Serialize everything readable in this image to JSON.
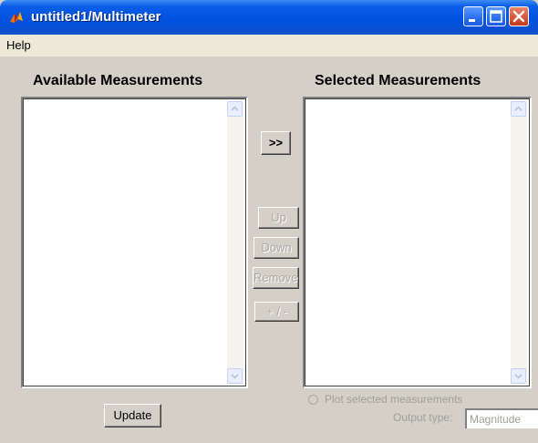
{
  "window": {
    "title": "untitled1/Multimeter",
    "controls": [
      "minimize-icon",
      "maximize-icon",
      "close-icon"
    ]
  },
  "menu": {
    "help": "Help"
  },
  "available": {
    "heading": "Available Measurements",
    "items": []
  },
  "selected": {
    "heading": "Selected Measurements",
    "items": []
  },
  "buttons": {
    "add": ">>",
    "up": "Up",
    "down": "Down",
    "remove": "Remove",
    "plus_minus": "+ / -",
    "update": "Update"
  },
  "plot_option": {
    "label": "Plot selected measurements",
    "checked": false,
    "enabled": false
  },
  "output_type": {
    "label": "Output type:",
    "value": "Magnitude"
  },
  "colors": {
    "titlebar": "#0053e0",
    "face": "#d4d0c8",
    "close": "#d9573a",
    "disabled_text": "#a09f99"
  }
}
